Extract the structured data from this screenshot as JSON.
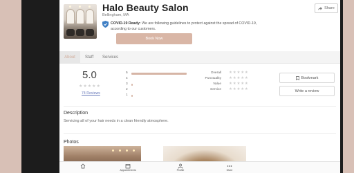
{
  "business": {
    "name": "Halo Beauty Salon",
    "location": "Bellingham, MA"
  },
  "share": {
    "label": "Share"
  },
  "covid": {
    "title": "COVID-19 Ready:",
    "text": "We are following guidelines to protect against the spread of COVID-19, according to our customers."
  },
  "book_button": {
    "label": "Book Now"
  },
  "tabs": [
    {
      "label": "About",
      "active": true
    },
    {
      "label": "Staff",
      "active": false
    },
    {
      "label": "Services",
      "active": false
    }
  ],
  "rating": {
    "score": "5.0",
    "stars": "★★★★★",
    "reviews_link": "74 Reviews",
    "distribution": [
      {
        "stars": "5",
        "fraction": 1.0
      },
      {
        "stars": "4",
        "fraction": 0.0
      },
      {
        "stars": "3",
        "fraction": 0.02
      },
      {
        "stars": "2",
        "fraction": 0.0
      },
      {
        "stars": "1",
        "fraction": 0.02
      }
    ],
    "categories": [
      {
        "label": "Overall",
        "stars": "★★★★★"
      },
      {
        "label": "Punctuality",
        "stars": "★★★★★"
      },
      {
        "label": "Value",
        "stars": "★★★★★"
      },
      {
        "label": "Service",
        "stars": "★★★★★"
      }
    ]
  },
  "actions": {
    "bookmark": "Bookmark",
    "write_review": "Write a review"
  },
  "description": {
    "heading": "Description",
    "text": "Servicing all of your hair needs in a clean friendly atmosphere."
  },
  "photos": {
    "heading": "Photos"
  },
  "bottom_nav": [
    {
      "label": "",
      "icon": "home-icon"
    },
    {
      "label": "Appointments",
      "icon": "calendar-icon"
    },
    {
      "label": "Profile",
      "icon": "person-icon"
    },
    {
      "label": "More",
      "icon": "more-icon"
    }
  ],
  "colors": {
    "accent": "#d9b6a6",
    "link": "#6577b8",
    "star_empty": "#cfcfcf"
  }
}
